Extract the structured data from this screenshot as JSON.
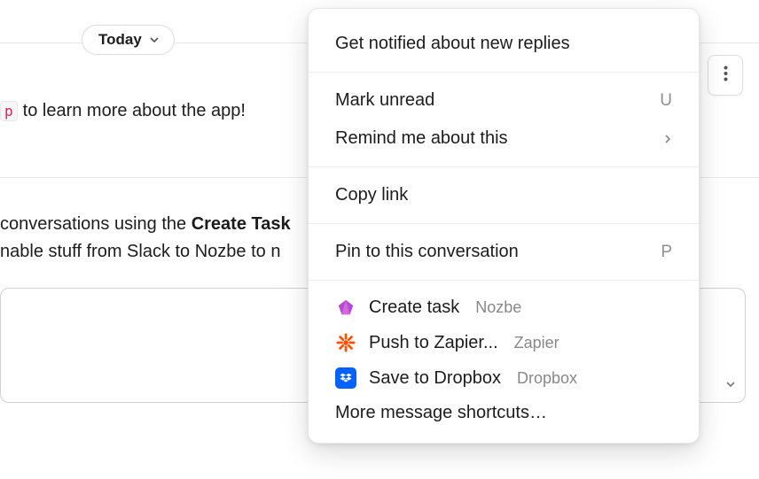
{
  "header": {
    "date_pill": "Today"
  },
  "messages": {
    "line1_code": "p",
    "line1_rest": "to learn more about the app!",
    "line2a_pre": "conversations using the ",
    "line2a_bold": "Create Task",
    "line2b": "nable stuff from Slack to Nozbe to n"
  },
  "context_menu": {
    "notify": "Get notified about new replies",
    "mark_unread": "Mark unread",
    "mark_unread_key": "U",
    "remind": "Remind me about this",
    "copy_link": "Copy link",
    "pin": "Pin to this conversation",
    "pin_key": "P",
    "apps": [
      {
        "label": "Create task",
        "sub": "Nozbe"
      },
      {
        "label": "Push to Zapier...",
        "sub": "Zapier"
      },
      {
        "label": "Save to Dropbox",
        "sub": "Dropbox"
      }
    ],
    "more": "More message shortcuts…"
  }
}
